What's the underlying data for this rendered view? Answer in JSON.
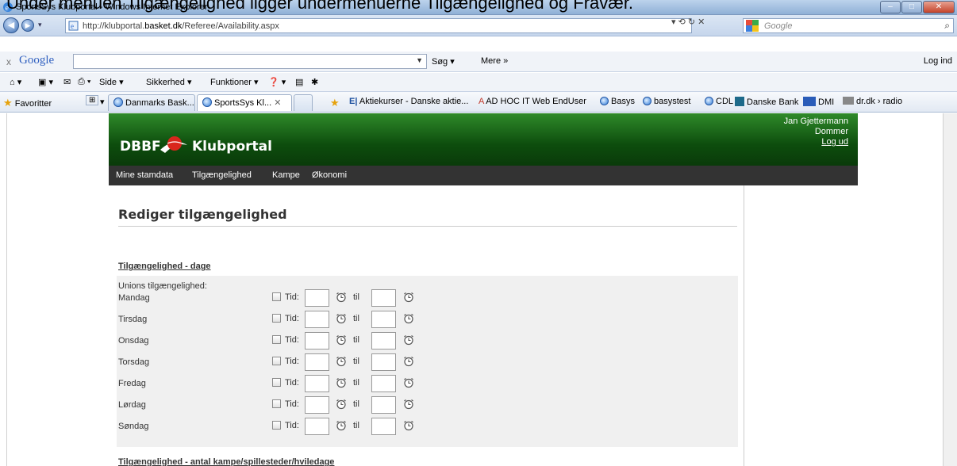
{
  "caption": "Under menuen Tilgængelighed ligger undermenuerne Tilgængelighed og Fravær.",
  "window": {
    "title": "SportsSys Klubportal - Windows Internet Explorer"
  },
  "browser": {
    "url_prefix": "http://klubportal.",
    "url_host": "basket.dk",
    "url_path": "/Referee/Availability.aspx",
    "search_placeholder": "Google",
    "google_bar": {
      "close": "x",
      "logo": "Google",
      "sog": "Søg ▾",
      "mere": "Mere »",
      "login": "Log ind"
    },
    "command_bar": [
      "Side ▾",
      "Sikkerhed ▾",
      "Funktioner ▾"
    ],
    "favorites_label": "Favoritter",
    "tabs": [
      {
        "label": "Danmarks Bask..."
      },
      {
        "label": "SportsSys Kl..."
      }
    ],
    "favorites": [
      "Aktiekurser - Danske aktie...",
      "AD HOC IT Web EndUser",
      "Basys",
      "basystest",
      "CDL",
      "Danske Bank",
      "DMI",
      "dr.dk › radio"
    ]
  },
  "portal": {
    "logo_left": "DBBF",
    "logo_right": "Klubportal",
    "user": {
      "name": "Jan Gjettermann",
      "role": "Dommer",
      "logout": "Log ud"
    },
    "menu": [
      "Mine stamdata",
      "Tilgængelighed",
      "Kampe",
      "Økonomi"
    ],
    "page_title": "Rediger tilgængelighed",
    "section1": "Tilgængelighed - dage",
    "union_label": "Unions tilgængelighed:",
    "time_label": "Tid:",
    "til_label": "til",
    "days": [
      "Mandag",
      "Tirsdag",
      "Onsdag",
      "Torsdag",
      "Fredag",
      "Lørdag",
      "Søndag"
    ],
    "section2": "Tilgængelighed - antal kampe/spillesteder/hviledage"
  },
  "colors": {
    "header_green": "#1f6b1c",
    "menu_dark": "#333333",
    "grid_bg": "#f0f0f0"
  }
}
